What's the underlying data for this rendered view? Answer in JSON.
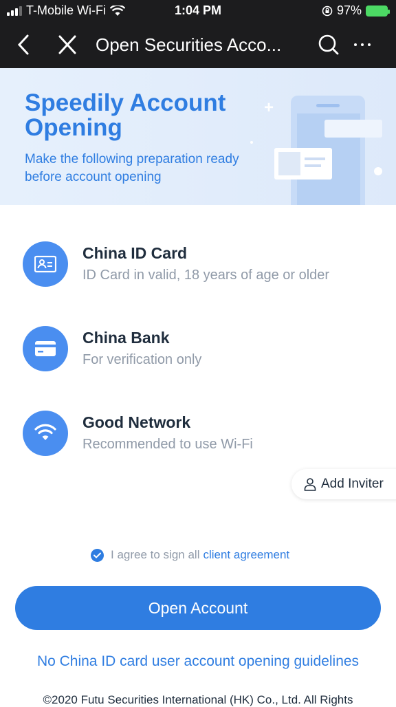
{
  "status_bar": {
    "carrier": "T-Mobile Wi-Fi",
    "time": "1:04 PM",
    "battery": "97%"
  },
  "nav": {
    "title": "Open Securities Acco..."
  },
  "banner": {
    "title": "Speedily Account Opening",
    "subtitle": "Make the following preparation ready before account opening"
  },
  "requirements": [
    {
      "title": "China ID Card",
      "description": "ID Card in valid, 18 years of age or older",
      "icon": "id-card-icon"
    },
    {
      "title": "China Bank",
      "description": "For verification only",
      "icon": "bank-card-icon"
    },
    {
      "title": "Good Network",
      "description": "Recommended to use Wi-Fi",
      "icon": "wifi-icon"
    }
  ],
  "add_inviter": {
    "label": "Add Inviter",
    "icon": "person-icon"
  },
  "agreement": {
    "text": "I agree to sign all",
    "link": "client agreement",
    "checked": true
  },
  "open_button": {
    "label": "Open Account"
  },
  "guidelines_link": "No China ID card user account opening guidelines",
  "copyright": "©2020 Futu Securities International (HK) Co., Ltd. All Rights",
  "colors": {
    "accent": "#2f7de1",
    "icon_bg": "#4a8ef0",
    "nav_bg": "#1c1c1e",
    "muted_text": "#909aa8"
  }
}
